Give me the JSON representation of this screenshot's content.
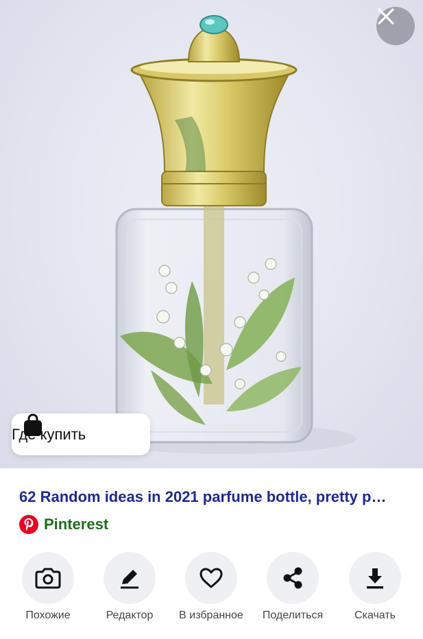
{
  "image": {
    "alt_subject": "perfume bottle"
  },
  "close_button": {
    "icon": "close-icon"
  },
  "buy_chip": {
    "label": "Где купить",
    "icon": "shopping-bag-icon"
  },
  "result": {
    "title": "62 Random ideas in 2021 parfume bottle, pretty p…",
    "source": {
      "name": "Pinterest",
      "icon": "pinterest-logo-icon"
    }
  },
  "actions": [
    {
      "label": "Похожие",
      "icon": "camera-search-icon"
    },
    {
      "label": "Редактор",
      "icon": "pencil-icon"
    },
    {
      "label": "В избранное",
      "icon": "heart-icon"
    },
    {
      "label": "Поделиться",
      "icon": "share-icon"
    },
    {
      "label": "Скачать",
      "icon": "download-icon"
    }
  ],
  "colors": {
    "title": "#1e2a8f",
    "source": "#1f6d1f",
    "pinterest": "#e60023",
    "action_bg": "#eef0f3"
  }
}
